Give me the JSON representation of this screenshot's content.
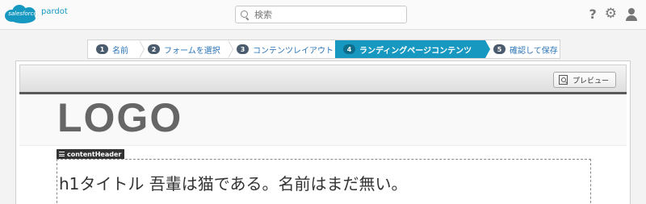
{
  "brand": {
    "logo_text": "salesforce",
    "product": "pardot",
    "color": "#1798c1"
  },
  "search": {
    "placeholder": "検索"
  },
  "header_icons": [
    "help-icon",
    "gear-icon",
    "user-icon"
  ],
  "help_glyph": "?",
  "wizard": {
    "steps": [
      {
        "num": "1",
        "label": "名前",
        "active": false
      },
      {
        "num": "2",
        "label": "フォームを選択",
        "active": false
      },
      {
        "num": "3",
        "label": "コンテンツレイアウト",
        "active": false
      },
      {
        "num": "4",
        "label": "ランディングページコンテンツ",
        "active": true
      },
      {
        "num": "5",
        "label": "確認して保存",
        "active": false
      }
    ]
  },
  "toolbar": {
    "preview_label": "プレビュー"
  },
  "page": {
    "logo": "LOGO",
    "region_label": "contentHeader",
    "heading": "h1タイトル 吾輩は猫である。名前はまだ無い。"
  }
}
